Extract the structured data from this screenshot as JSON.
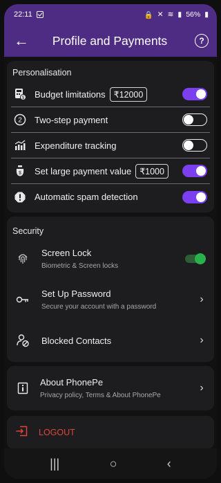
{
  "status": {
    "time": "22:11",
    "battery": "56%"
  },
  "header": {
    "title": "Profile and Payments"
  },
  "personalisation": {
    "title": "Personalisation",
    "items": [
      {
        "label": "Budget limitations",
        "amount": "₹12000",
        "toggle": "on"
      },
      {
        "label": "Two-step payment",
        "toggle": "off"
      },
      {
        "label": "Expenditure tracking",
        "toggle": "off"
      },
      {
        "label": "Set large payment value",
        "amount": "₹1000",
        "toggle": "on"
      },
      {
        "label": "Automatic spam detection",
        "toggle": "on"
      }
    ]
  },
  "security": {
    "title": "Security",
    "screen_lock": {
      "title": "Screen Lock",
      "subtitle": "Biometric & Screen locks"
    },
    "password": {
      "title": "Set Up Password",
      "subtitle": "Secure your account with a password"
    },
    "blocked": {
      "title": "Blocked Contacts"
    }
  },
  "about": {
    "title": "About PhonePe",
    "subtitle": "Privacy policy, Terms & About PhonePe"
  },
  "logout": {
    "label": "LOGOUT"
  },
  "colors": {
    "accent": "#7c3ff0",
    "header": "#4f2c83",
    "logout": "#e0453a",
    "toggle_green": "#29b14a"
  }
}
